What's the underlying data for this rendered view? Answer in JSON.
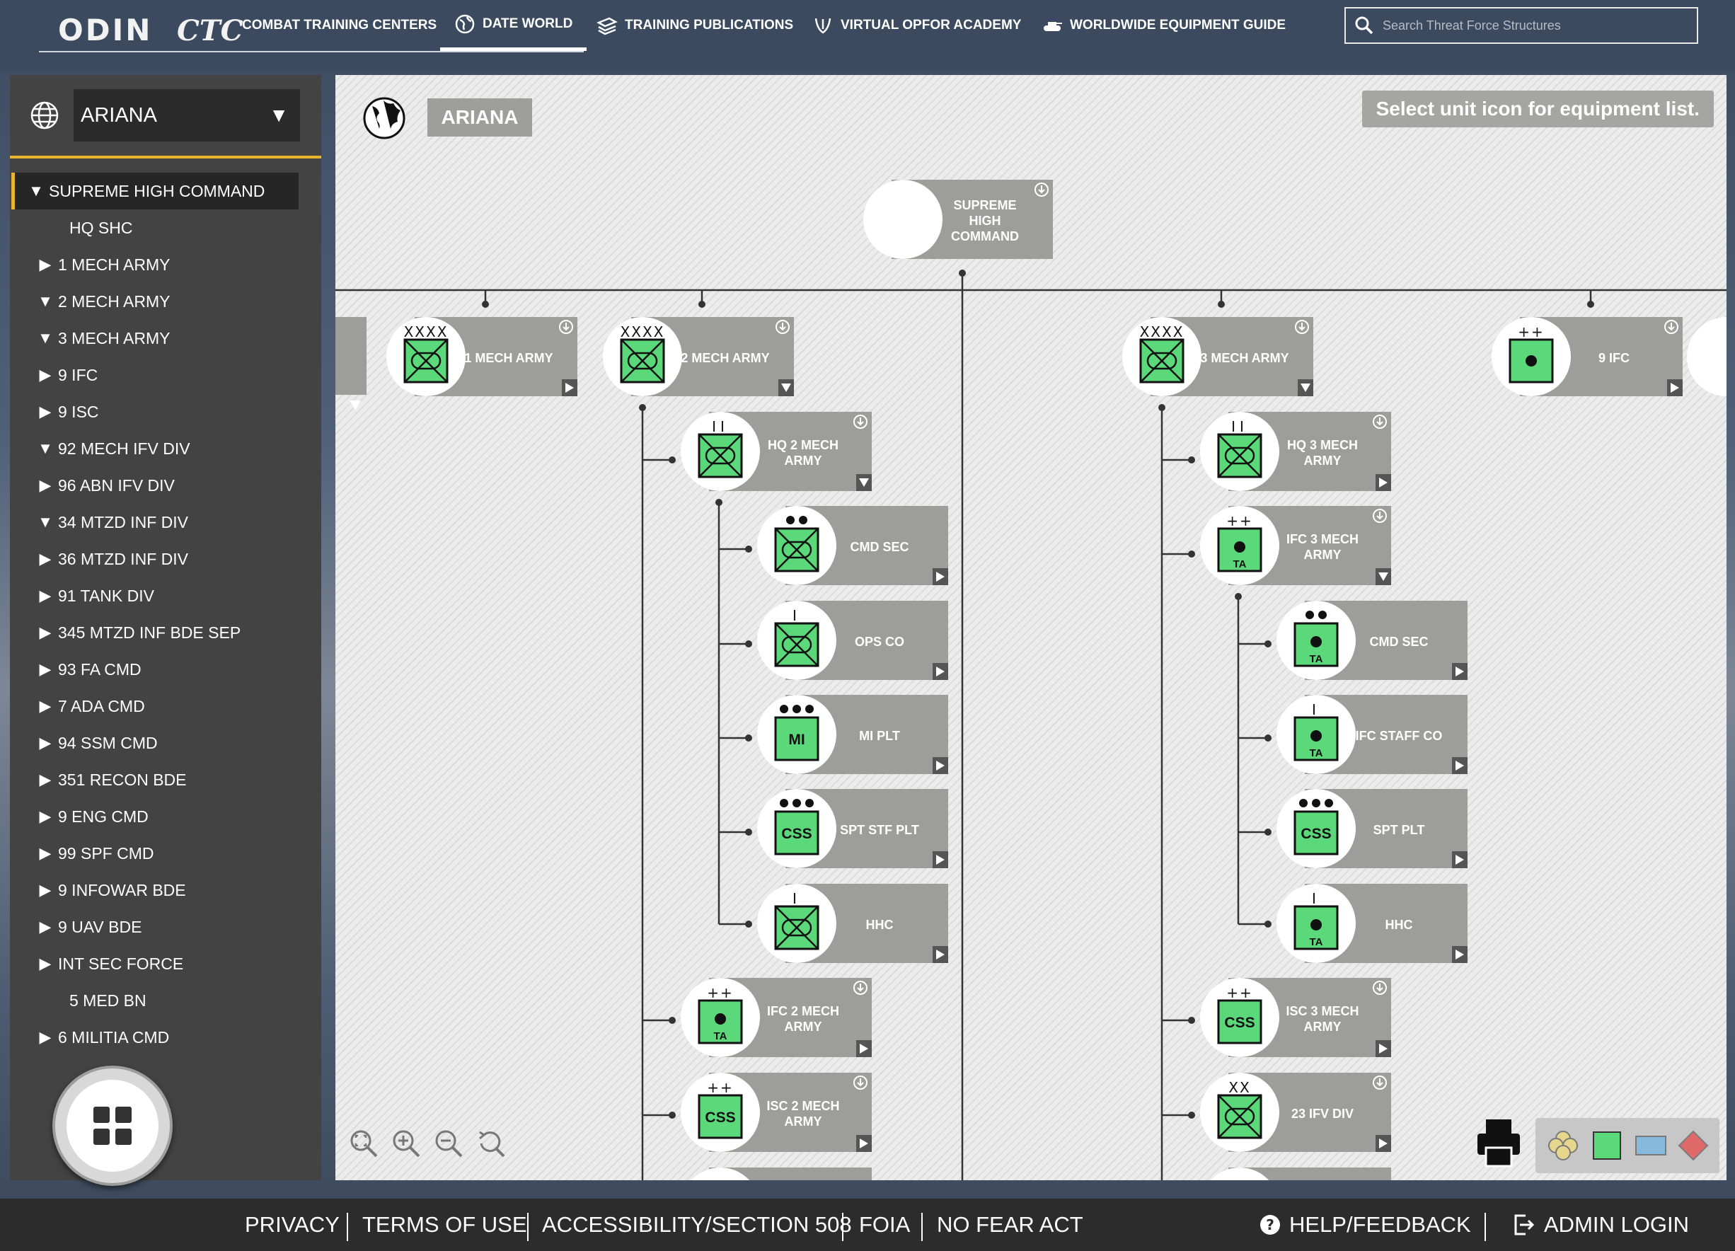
{
  "header": {
    "logo_odin": "ODIN",
    "logo_ctc": "CTC",
    "nav": [
      {
        "label": "COMBAT TRAINING CENTERS"
      },
      {
        "label": "DATE WORLD"
      },
      {
        "label": "TRAINING PUBLICATIONS"
      },
      {
        "label": "VIRTUAL OPFOR ACADEMY"
      },
      {
        "label": "WORLDWIDE EQUIPMENT GUIDE"
      }
    ],
    "search_placeholder": "Search Threat Force Structures"
  },
  "sidebar": {
    "country_select": "ARIANA",
    "tree": [
      {
        "label": "SUPREME HIGH COMMAND",
        "arrow": "▼",
        "level": 0
      },
      {
        "label": "HQ SHC",
        "arrow": "",
        "level": 1
      },
      {
        "label": "1 MECH ARMY",
        "arrow": "▶",
        "level": 1
      },
      {
        "label": "2 MECH ARMY",
        "arrow": "▼",
        "level": 1
      },
      {
        "label": "3 MECH ARMY",
        "arrow": "▼",
        "level": 1
      },
      {
        "label": "9 IFC",
        "arrow": "▶",
        "level": 1
      },
      {
        "label": "9 ISC",
        "arrow": "▶",
        "level": 1
      },
      {
        "label": "92 MECH IFV DIV",
        "arrow": "▼",
        "level": 1
      },
      {
        "label": "96 ABN IFV DIV",
        "arrow": "▶",
        "level": 1
      },
      {
        "label": "34 MTZD INF DIV",
        "arrow": "▼",
        "level": 1
      },
      {
        "label": "36 MTZD INF DIV",
        "arrow": "▶",
        "level": 1
      },
      {
        "label": "91 TANK DIV",
        "arrow": "▶",
        "level": 1
      },
      {
        "label": "345 MTZD INF BDE SEP",
        "arrow": "▶",
        "level": 1
      },
      {
        "label": "93 FA CMD",
        "arrow": "▶",
        "level": 1
      },
      {
        "label": "7 ADA CMD",
        "arrow": "▶",
        "level": 1
      },
      {
        "label": "94 SSM CMD",
        "arrow": "▶",
        "level": 1
      },
      {
        "label": "351 RECON BDE",
        "arrow": "▶",
        "level": 1
      },
      {
        "label": "9 ENG CMD",
        "arrow": "▶",
        "level": 1
      },
      {
        "label": "99 SPF CMD",
        "arrow": "▶",
        "level": 1
      },
      {
        "label": "9 INFOWAR BDE",
        "arrow": "▶",
        "level": 1
      },
      {
        "label": "9 UAV BDE",
        "arrow": "▶",
        "level": 1
      },
      {
        "label": "INT SEC FORCE",
        "arrow": "▶",
        "level": 1
      },
      {
        "label": "5 MED BN",
        "arrow": "",
        "level": 1
      },
      {
        "label": "6 MILITIA CMD",
        "arrow": "▶",
        "level": 1
      }
    ]
  },
  "canvas": {
    "title": "ARIANA",
    "hint": "Select unit icon for equipment list.",
    "units": {
      "shc": {
        "name": "SUPREME HIGH COMMAND",
        "echelon": "",
        "symbol": "blank"
      },
      "partial_left": {
        "name": "",
        "echelon": "",
        "symbol": "none"
      },
      "ma1": {
        "name": "1 MECH ARMY",
        "echelon": "XXXX",
        "symbol": "mech"
      },
      "ma2": {
        "name": "2 MECH ARMY",
        "echelon": "XXXX",
        "symbol": "mech"
      },
      "ma3": {
        "name": "3 MECH ARMY",
        "echelon": "XXXX",
        "symbol": "mech"
      },
      "ifc9": {
        "name": "9 IFC",
        "echelon": "++",
        "symbol": "dot"
      },
      "hq2": {
        "name": "HQ 2 MECH ARMY",
        "echelon": "II",
        "symbol": "mech"
      },
      "cmd2": {
        "name": "CMD SEC",
        "echelon": "●●",
        "symbol": "mech"
      },
      "ops2": {
        "name": "OPS CO",
        "echelon": "I",
        "symbol": "mech"
      },
      "mi2": {
        "name": "MI PLT",
        "echelon": "●●●",
        "symbol": "text",
        "text": "MI"
      },
      "spt2": {
        "name": "SPT STF PLT",
        "echelon": "●●●",
        "symbol": "text",
        "text": "CSS"
      },
      "hhc2": {
        "name": "HHC",
        "echelon": "I",
        "symbol": "mech"
      },
      "ifc2": {
        "name": "IFC 2 MECH ARMY",
        "echelon": "++",
        "symbol": "ta",
        "text": "TA"
      },
      "isc2": {
        "name": "ISC 2 MECH ARMY",
        "echelon": "++",
        "symbol": "text",
        "text": "CSS"
      },
      "hq3": {
        "name": "HQ 3 MECH ARMY",
        "echelon": "II",
        "symbol": "mech"
      },
      "ifc3": {
        "name": "IFC 3 MECH ARMY",
        "echelon": "++",
        "symbol": "ta",
        "text": "TA"
      },
      "cmd3": {
        "name": "CMD SEC",
        "echelon": "●●",
        "symbol": "ta",
        "text": "TA"
      },
      "ifcstaff3": {
        "name": "IFC STAFF CO",
        "echelon": "I",
        "symbol": "ta",
        "text": "TA"
      },
      "spt3": {
        "name": "SPT PLT",
        "echelon": "●●●",
        "symbol": "text",
        "text": "CSS"
      },
      "hhc3": {
        "name": "HHC",
        "echelon": "I",
        "symbol": "ta",
        "text": "TA"
      },
      "isc3": {
        "name": "ISC 3 MECH ARMY",
        "echelon": "++",
        "symbol": "text",
        "text": "CSS"
      },
      "div23": {
        "name": "23 IFV DIV",
        "echelon": "XX",
        "symbol": "mech"
      }
    }
  },
  "colors": {
    "unit_green": "#5bd87a",
    "card_gray": "#9d9d9a",
    "accent_gold": "#e7b62e",
    "header_bg": "#3b4a5f",
    "sidebar_bg": "#434343",
    "footer_bg": "#2c2c2c"
  },
  "icons": [
    "globe-icon",
    "search-icon",
    "printer-icon",
    "apps-grid-icon",
    "zoom-fit-icon",
    "zoom-in-icon",
    "zoom-out-icon",
    "zoom-reset-icon",
    "help-icon",
    "login-icon",
    "download-icon",
    "expand-arrow-icon"
  ],
  "footer": {
    "links": [
      "PRIVACY",
      "TERMS OF USE",
      "ACCESSIBILITY/SECTION 508",
      "FOIA",
      "NO FEAR ACT"
    ],
    "help": "HELP/FEEDBACK",
    "admin": "ADMIN LOGIN"
  }
}
